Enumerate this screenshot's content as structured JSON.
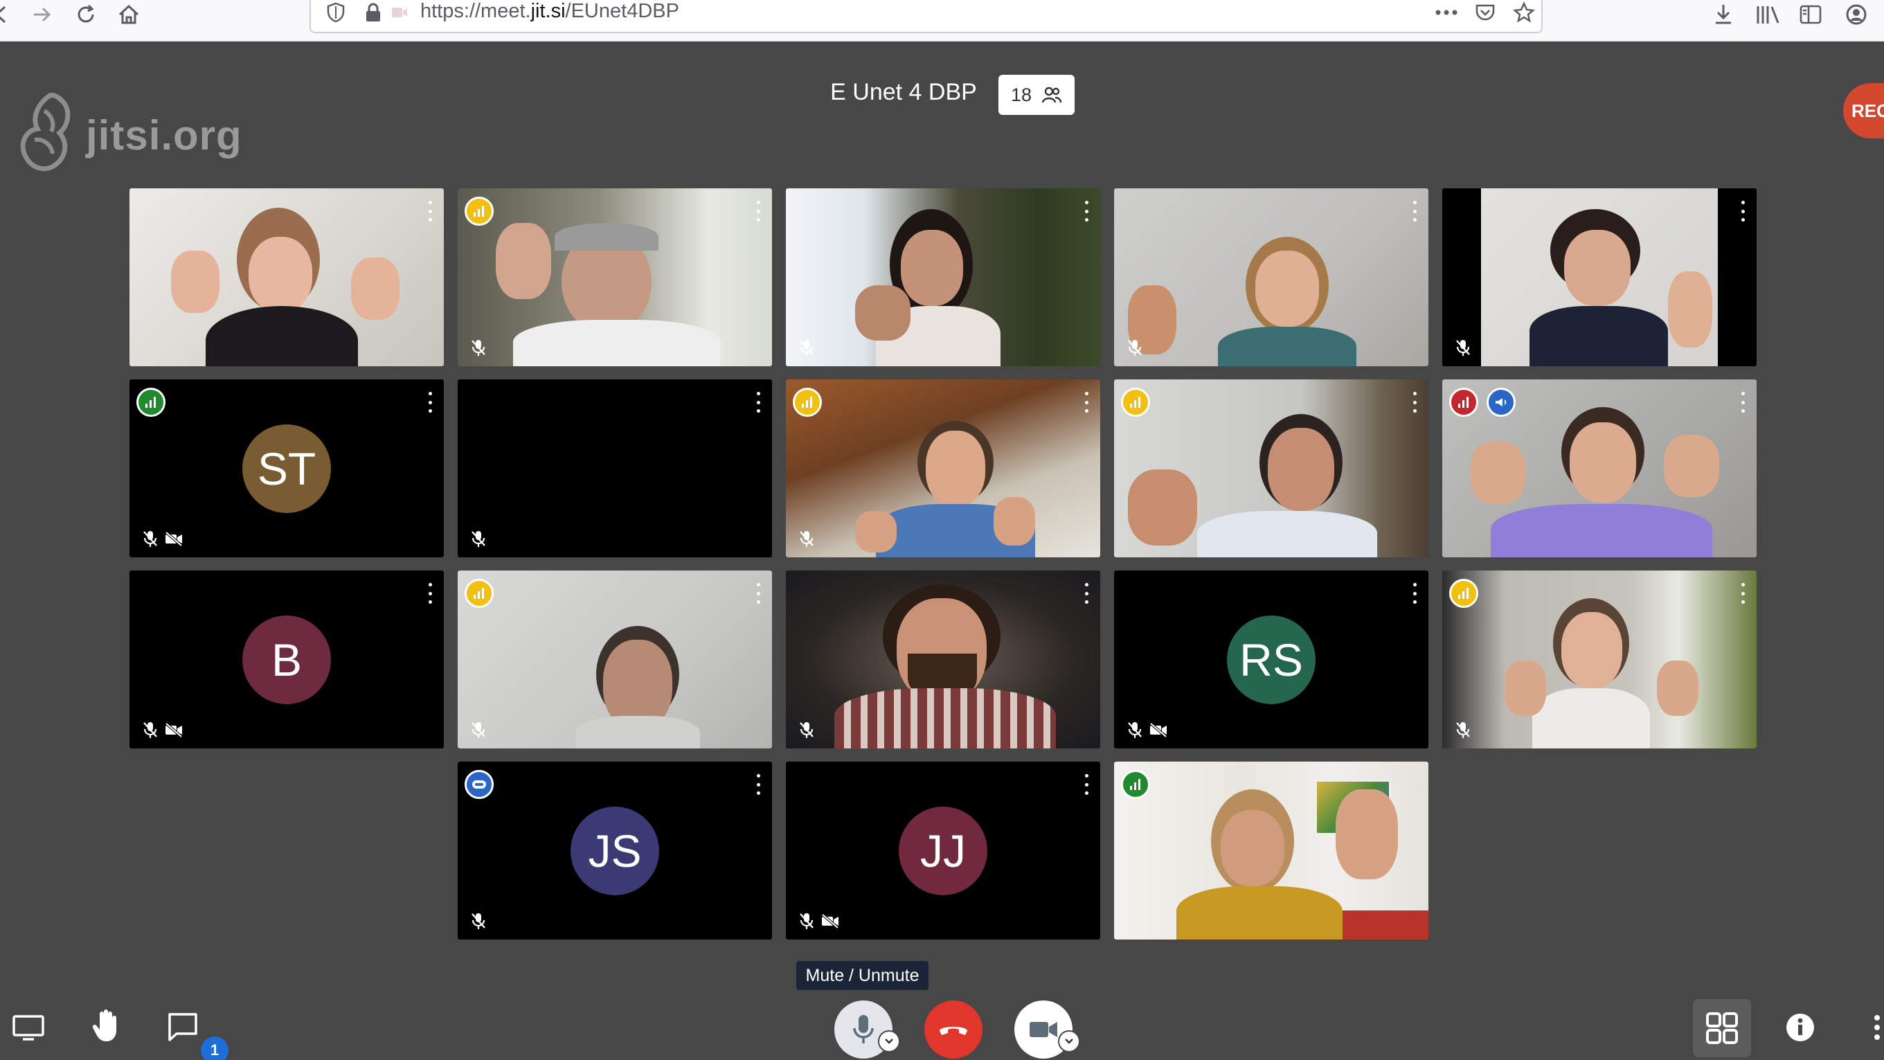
{
  "browser": {
    "url_prefix": "https://meet.",
    "url_domain": "jit.si",
    "url_path": "/EUnet4DBP"
  },
  "meeting": {
    "logo_text": "jitsi.org",
    "title": "E Unet 4 DBP",
    "participant_count": "18",
    "recording_label": "REC"
  },
  "tiles": [
    {
      "label": "video-1"
    },
    {
      "label": "video-2"
    },
    {
      "label": "video-3"
    },
    {
      "label": "video-4"
    },
    {
      "label": "video-5"
    },
    {
      "initials": "ST",
      "avatar_color": "#7a5c32"
    },
    {
      "label": "video-off"
    },
    {
      "label": "video-8"
    },
    {
      "label": "video-9"
    },
    {
      "label": "video-10"
    },
    {
      "initials": "B",
      "avatar_color": "#6e2a3f"
    },
    {
      "label": "video-12"
    },
    {
      "label": "video-13"
    },
    {
      "initials": "RS",
      "avatar_color": "#25664f"
    },
    {
      "label": "video-15"
    },
    {
      "initials": "JS",
      "avatar_color": "#3b3a74"
    },
    {
      "initials": "JJ",
      "avatar_color": "#70293d"
    },
    {
      "label": "video-18"
    }
  ],
  "toolbar": {
    "tooltip": "Mute / Unmute",
    "chat_unread": "1"
  },
  "colors": {
    "background": "#474747",
    "accent_blue": "#2a66c7",
    "hangup_red": "#e0362c",
    "quality_green": "#1f8a2e",
    "quality_yellow": "#f2c010",
    "quality_red": "#c6262e"
  }
}
